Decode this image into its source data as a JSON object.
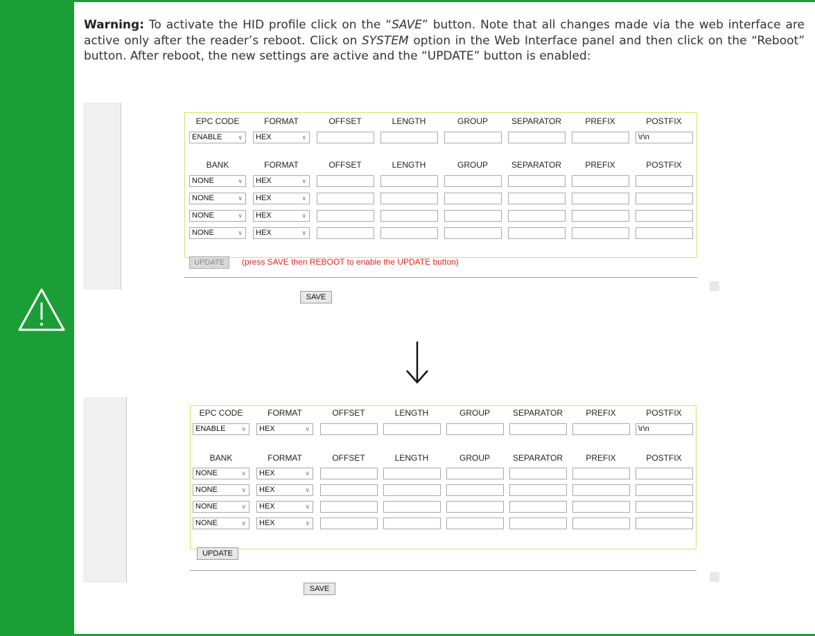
{
  "warning": {
    "label": "Warning:",
    "text_parts": [
      " To activate the HID profile click on the “",
      "SAVE",
      "” button. Note that all changes made via the web interface are active only after the reader’s reboot. Click on ",
      "SYSTEM",
      " option in the Web Interface panel and then click on the “Reboot” button. After reboot, the new settings are active and the “UPDATE” button is enabled:"
    ]
  },
  "arrow_icon": "down-arrow-icon",
  "screenshots": [
    {
      "epc_headers": [
        "EPC CODE",
        "FORMAT",
        "OFFSET",
        "LENGTH",
        "GROUP",
        "SEPARATOR",
        "PREFIX",
        "POSTFIX"
      ],
      "epc_row": {
        "code": "ENABLE",
        "format": "HEX",
        "offset": "",
        "length": "",
        "group": "",
        "separator": "",
        "prefix": "",
        "postfix": "\\r\\n"
      },
      "bank_headers": [
        "BANK",
        "FORMAT",
        "OFFSET",
        "LENGTH",
        "GROUP",
        "SEPARATOR",
        "PREFIX",
        "POSTFIX"
      ],
      "bank_rows": [
        {
          "bank": "NONE",
          "format": "HEX"
        },
        {
          "bank": "NONE",
          "format": "HEX"
        },
        {
          "bank": "NONE",
          "format": "HEX"
        },
        {
          "bank": "NONE",
          "format": "HEX"
        }
      ],
      "update_label": "UPDATE",
      "update_enabled": false,
      "note": "(press SAVE then REBOOT to enable the UPDATE button)",
      "save_label": "SAVE"
    },
    {
      "epc_headers": [
        "EPC CODE",
        "FORMAT",
        "OFFSET",
        "LENGTH",
        "GROUP",
        "SEPARATOR",
        "PREFIX",
        "POSTFIX"
      ],
      "epc_row": {
        "code": "ENABLE",
        "format": "HEX",
        "offset": "",
        "length": "",
        "group": "",
        "separator": "",
        "prefix": "",
        "postfix": "\\r\\n"
      },
      "bank_headers": [
        "BANK",
        "FORMAT",
        "OFFSET",
        "LENGTH",
        "GROUP",
        "SEPARATOR",
        "PREFIX",
        "POSTFIX"
      ],
      "bank_rows": [
        {
          "bank": "NONE",
          "format": "HEX"
        },
        {
          "bank": "NONE",
          "format": "HEX"
        },
        {
          "bank": "NONE",
          "format": "HEX"
        },
        {
          "bank": "NONE",
          "format": "HEX"
        }
      ],
      "update_label": "UPDATE",
      "update_enabled": true,
      "note": "",
      "save_label": "SAVE"
    }
  ],
  "colors": {
    "accent": "#1a9e35",
    "note": "#e8241c",
    "frame": "#d6e36a"
  }
}
